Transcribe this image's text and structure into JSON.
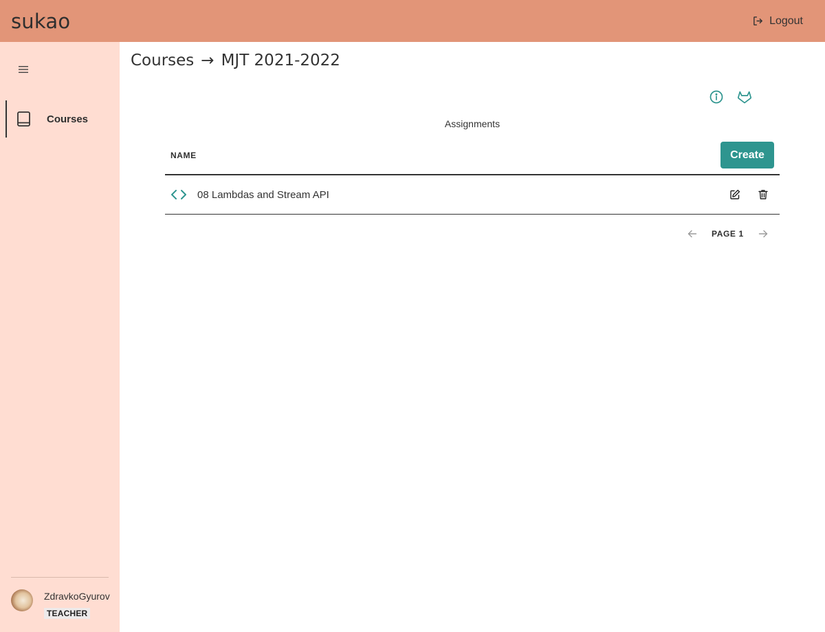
{
  "header": {
    "brand": "sukao",
    "logout_label": "Logout"
  },
  "sidebar": {
    "items": [
      {
        "label": "Courses",
        "icon": "book-icon"
      }
    ],
    "user": {
      "name": "ZdravkoGyurov",
      "role": "TEACHER"
    }
  },
  "breadcrumb": {
    "parent": "Courses",
    "separator": "→",
    "current": "MJT 2021-2022"
  },
  "assignments": {
    "title": "Assignments",
    "column_name": "NAME",
    "create_label": "Create",
    "rows": [
      {
        "name": "08 Lambdas and Stream API",
        "icon": "code-icon"
      }
    ]
  },
  "pagination": {
    "label": "PAGE 1"
  },
  "colors": {
    "header": "#e29578",
    "sidebar": "#ffddd2",
    "accent": "#2e958f"
  }
}
